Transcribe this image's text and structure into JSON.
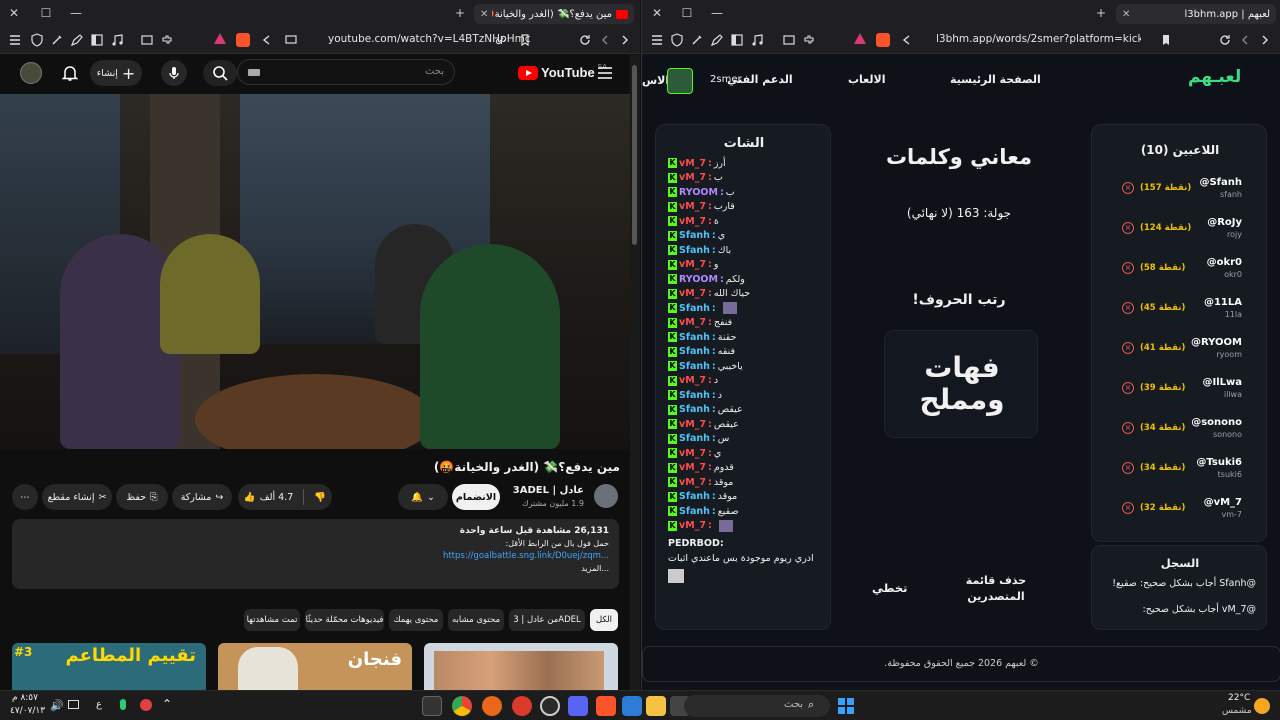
{
  "left_window": {
    "tab": {
      "title": "مين يدفع؟💸 (الغدر والخيانة🤬)",
      "badge": ""
    },
    "url": "youtube.com/watch?v=L4BTzNHpHmc",
    "youtube": {
      "logo_text": "YouTube",
      "region": "SA",
      "search_placeholder": "بحث",
      "create_label": "إنشاء",
      "video_title": "مين يدفع؟💸 (الغدر والخيانة🤬)",
      "channel_name": "عادل | 3ADEL",
      "subscribers": "1.9 مليون مشترك",
      "join_label": "الانضمام",
      "likes": "4.7 ألف",
      "share_label": "مشاركة",
      "save_label": "حفظ",
      "clip_label": "إنشاء مقطع",
      "description": {
        "views": "26,131 مشاهدة قبل ساعة واحدة",
        "line1": "حمل فول بال من الرابط الأقل:",
        "link": "https://goalbattle.sng.link/D0uej/zqm...",
        "more": "...المزيد"
      },
      "chips": [
        "الكل",
        "من عادل | 3ADEL",
        "محتوى مشابه",
        "محتوى يهمك",
        "فيديوهات محمّلة حديثًا",
        "تمت مشاهدتها"
      ],
      "thumbnails": [
        {
          "text": "تقييم المطاعم",
          "badge": "#3"
        },
        {
          "text": "فنجان",
          "badge": ""
        },
        {
          "text": "",
          "badge": ""
        }
      ]
    }
  },
  "right_window": {
    "tab": {
      "title": "لعبهم | l3bhm.app"
    },
    "url": "l3bhm.app/words/2smer?platform=kick",
    "nav": {
      "logo": "لعبـهم",
      "home": "الصفحة الرئيسية",
      "games": "الالعاب",
      "support": "الدعم الفني",
      "user": "2smer",
      "cut": "الاس"
    },
    "players": {
      "title": "اللاعبين (10)",
      "list": [
        {
          "name": "@Sfanh",
          "sub": "sfanh",
          "points": "(157 نقطة)"
        },
        {
          "name": "@RoJy",
          "sub": "rojy",
          "points": "(124 نقطة)"
        },
        {
          "name": "@okr0",
          "sub": "okr0",
          "points": "(58 نقطة)"
        },
        {
          "name": "@11LA",
          "sub": "11la",
          "points": "(45 نقطة)"
        },
        {
          "name": "@RYOOM",
          "sub": "ryoom",
          "points": "(41 نقطة)"
        },
        {
          "name": "@IlLwa",
          "sub": "illwa",
          "points": "(39 نقطة)"
        },
        {
          "name": "@sonono",
          "sub": "sonono",
          "points": "(34 نقطة)"
        },
        {
          "name": "@Tsuki6",
          "sub": "tsuki6",
          "points": "(34 نقطة)"
        },
        {
          "name": "@vM_7",
          "sub": "vm-7",
          "points": "(32 نقطة)"
        }
      ]
    },
    "log": {
      "title": "السجل",
      "entries": [
        "@Sfanh أجاب بشكل صحيح: صقيع!",
        "@vM_7 أجاب بشكل صحيح:"
      ]
    },
    "game": {
      "title": "معاني وكلمات",
      "round": "جولة: 163 (لا نهائي)",
      "prompt": "رتب الحروف!",
      "word_line1": "فهات",
      "word_line2": "ومملح",
      "clear_board": "حذف قائمة المتصدرين",
      "skip": "تخطي"
    },
    "chat": {
      "title": "الشات",
      "messages": [
        {
          "user": "vM_7",
          "text": "أرز"
        },
        {
          "user": "vM_7",
          "text": "ب"
        },
        {
          "user": "RYOOM",
          "text": "ب"
        },
        {
          "user": "vM_7",
          "text": "قارب"
        },
        {
          "user": "vM_7",
          "text": "ة"
        },
        {
          "user": "Sfanh",
          "text": "ي"
        },
        {
          "user": "Sfanh",
          "text": "باك"
        },
        {
          "user": "vM_7",
          "text": "و"
        },
        {
          "user": "RYOOM",
          "text": "ولكم"
        },
        {
          "user": "vM_7",
          "text": "حياك الله"
        },
        {
          "user": "Sfanh",
          "text": ""
        },
        {
          "user": "vM_7",
          "text": "فنفج"
        },
        {
          "user": "Sfanh",
          "text": "حقنة"
        },
        {
          "user": "Sfanh",
          "text": "فنقه"
        },
        {
          "user": "Sfanh",
          "text": "ياخيبي"
        },
        {
          "user": "vM_7",
          "text": "د"
        },
        {
          "user": "Sfanh",
          "text": "د"
        },
        {
          "user": "Sfanh",
          "text": "عيقص"
        },
        {
          "user": "vM_7",
          "text": "عيقص"
        },
        {
          "user": "Sfanh",
          "text": "س"
        },
        {
          "user": "vM_7",
          "text": "ي"
        },
        {
          "user": "vM_7",
          "text": "قدوم"
        },
        {
          "user": "vM_7",
          "text": "موقد"
        },
        {
          "user": "Sfanh",
          "text": "موقد"
        },
        {
          "user": "Sfanh",
          "text": "صقيع"
        },
        {
          "user": "vM_7",
          "text": ""
        }
      ],
      "last_user": "PEDRBOD:",
      "last_text": "ادري ريوم موجودة بس ماعندي اثبات"
    },
    "footer": "© لعبهم 2026 جميع الحقوق محفوظة."
  },
  "taskbar": {
    "search_placeholder": "بحث",
    "weather_temp": "22°C",
    "weather_desc": "مشمس",
    "time": "٨:٥٧ م",
    "date": "٤٧/٠٧/١٣",
    "lang": "ع"
  }
}
